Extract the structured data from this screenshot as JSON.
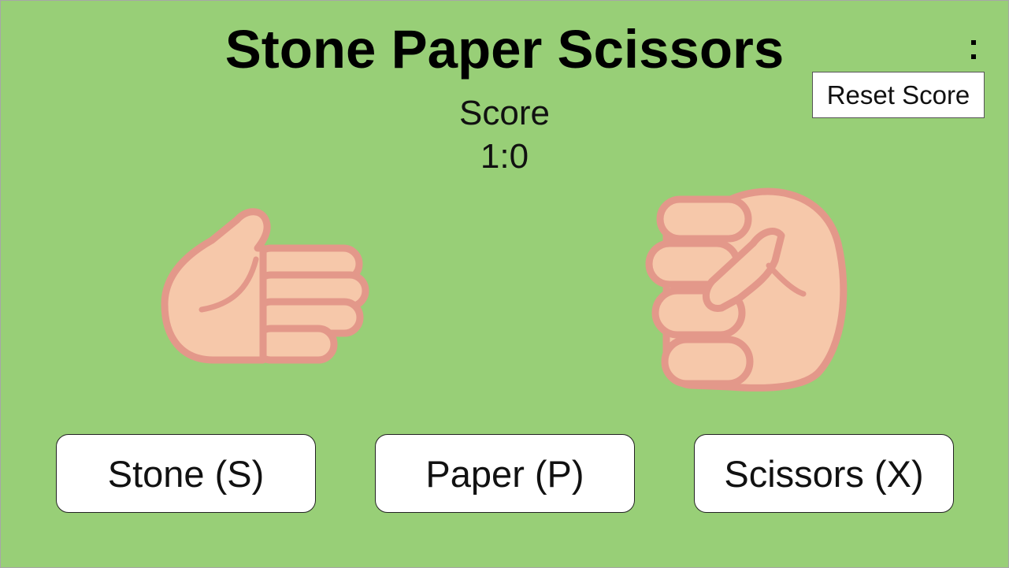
{
  "game": {
    "title": "Stone Paper Scissors",
    "score_label": "Score",
    "score_value": "1:0",
    "reset_label": "Reset Score"
  },
  "hands": {
    "player": "paper-hand-icon",
    "computer": "stone-fist-icon"
  },
  "choices": {
    "stone": "Stone (S)",
    "paper": "Paper (P)",
    "scissors": "Scissors (X)"
  },
  "colors": {
    "background": "#98cf77",
    "skin": "#f6c8aa",
    "skin_outline": "#e3988a"
  }
}
